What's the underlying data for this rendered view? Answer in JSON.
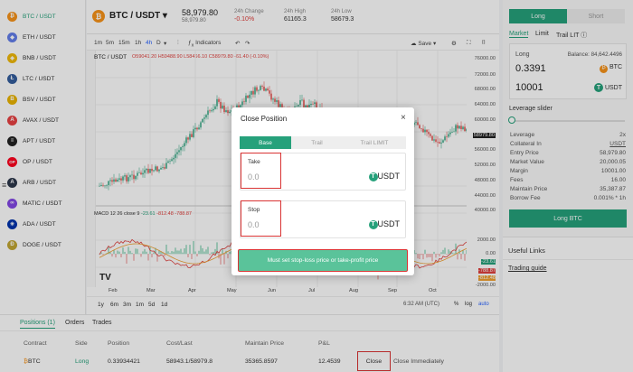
{
  "sidebar": {
    "items": [
      {
        "label": "BTC / USDT",
        "icon": "bitcoin-icon",
        "color": "#f7931a",
        "glyph": "₿"
      },
      {
        "label": "ETH / USDT",
        "icon": "ethereum-icon",
        "color": "#627eea",
        "glyph": "◆"
      },
      {
        "label": "BNB / USDT",
        "icon": "bnb-icon",
        "color": "#f0b90b",
        "glyph": "◈"
      },
      {
        "label": "LTC / USDT",
        "icon": "litecoin-icon",
        "color": "#345d9d",
        "glyph": "Ł"
      },
      {
        "label": "BSV / USDT",
        "icon": "bsv-icon",
        "color": "#eab300",
        "glyph": "B"
      },
      {
        "label": "AVAX / USDT",
        "icon": "avax-icon",
        "color": "#e84142",
        "glyph": "A"
      },
      {
        "label": "APT / USDT",
        "icon": "aptos-icon",
        "color": "#222222",
        "glyph": "≡"
      },
      {
        "label": "OP / USDT",
        "icon": "optimism-icon",
        "color": "#ff0420",
        "glyph": "OP"
      },
      {
        "label": "ARB / USDT",
        "icon": "arbitrum-icon",
        "color": "#2d374b",
        "glyph": "A"
      },
      {
        "label": "MATIC / USDT",
        "icon": "polygon-icon",
        "color": "#8247e5",
        "glyph": "∞"
      },
      {
        "label": "ADA / USDT",
        "icon": "cardano-icon",
        "color": "#0033ad",
        "glyph": "✳"
      },
      {
        "label": "DOGE / USDT",
        "icon": "doge-icon",
        "color": "#c2a633",
        "glyph": "Ð"
      }
    ]
  },
  "header": {
    "pair": "BTC / USDT",
    "price": "58,979.80",
    "price_sub": "58,979.80",
    "change_label": "24h Change",
    "change_value": "-0.10%",
    "high_label": "24h High",
    "high_value": "61165.3",
    "low_label": "24h Low",
    "low_value": "58679.3"
  },
  "chart": {
    "intervals": [
      "1m",
      "5m",
      "15m",
      "1h",
      "4h",
      "D"
    ],
    "indicators_label": "Indicators",
    "save_label": "Save",
    "legend_pair": "BTC / USDT",
    "ohlc": "O59041.20 H59488.90 L58466.10 C58979.80 -61.40 (-0.10%)",
    "macd_label": "MACD 12 26 close 9",
    "macd_values": [
      "-23.61",
      "-812.48",
      "-788.87"
    ],
    "price_ticks": [
      "76000.00",
      "72000.00",
      "68000.00",
      "64000.00",
      "60000.00",
      "58979.80",
      "56000.00",
      "52000.00",
      "48000.00",
      "44000.00",
      "40000.00"
    ],
    "macd_ticks": [
      "2000.00",
      "0.00",
      "-23.61",
      "-788.87",
      "-812.48",
      "-2000.00"
    ],
    "x_labels": [
      "Feb",
      "Mar",
      "Apr",
      "May",
      "Jun",
      "Jul",
      "Aug",
      "Sep",
      "Oct"
    ],
    "ranges": [
      "1y",
      "6m",
      "3m",
      "1m",
      "5d",
      "1d"
    ],
    "time": "6:32 AM (UTC)",
    "pct": "%",
    "log": "log",
    "auto": "auto"
  },
  "bottom": {
    "tabs": [
      "Positions (1)",
      "Orders",
      "Trades"
    ],
    "columns": [
      "Contract",
      "Side",
      "Position",
      "Cost/Last",
      "Maintain Price",
      "P&L"
    ],
    "row": {
      "contract": "BTC",
      "side": "Long",
      "position": "0.33934421",
      "cost_last": "58943.1/58979.8",
      "maintain_price": "35365.8597",
      "pnl": "12.4539",
      "close": "Close",
      "close_immediately": "Close Immediately"
    }
  },
  "right_panel": {
    "long": "Long",
    "short": "Short",
    "order_tabs": [
      "Market",
      "Limit",
      "Trail LIT"
    ],
    "amount": "0.3391",
    "balance": "Balance: 84,642.4496",
    "amount_currency": "BTC",
    "usd_amount": "10001",
    "usd_currency": "USDT",
    "leverage_slider": "Leverage slider",
    "rows": [
      {
        "label": "Leverage",
        "value": "2x"
      },
      {
        "label": "Collateral In",
        "value": "USDT"
      },
      {
        "label": "Entry Price",
        "value": "58,979.80"
      },
      {
        "label": "Market Value",
        "value": "20,000.05"
      },
      {
        "label": "Margin",
        "value": "10001.00"
      },
      {
        "label": "Fees",
        "value": "16.00"
      },
      {
        "label": "Maintain Price",
        "value": "35,387.87"
      },
      {
        "label": "Borrow Fee",
        "value": "0.001% * 1h"
      }
    ],
    "long_btn": "Long BTC",
    "useful_links": "Useful Links",
    "trading_guide": "Trading guide"
  },
  "modal": {
    "title": "Close Position",
    "tabs": [
      "Base",
      "Trail",
      "Trail LIMIT"
    ],
    "take_label": "Take",
    "take_placeholder": "0.0",
    "stop_label": "Stop",
    "stop_placeholder": "0.0",
    "currency": "USDT",
    "submit": "Must set stop-loss price or take-profit price"
  },
  "colors": {
    "accent": "#26a17b",
    "down": "#e0413e",
    "up": "#26a17b"
  }
}
